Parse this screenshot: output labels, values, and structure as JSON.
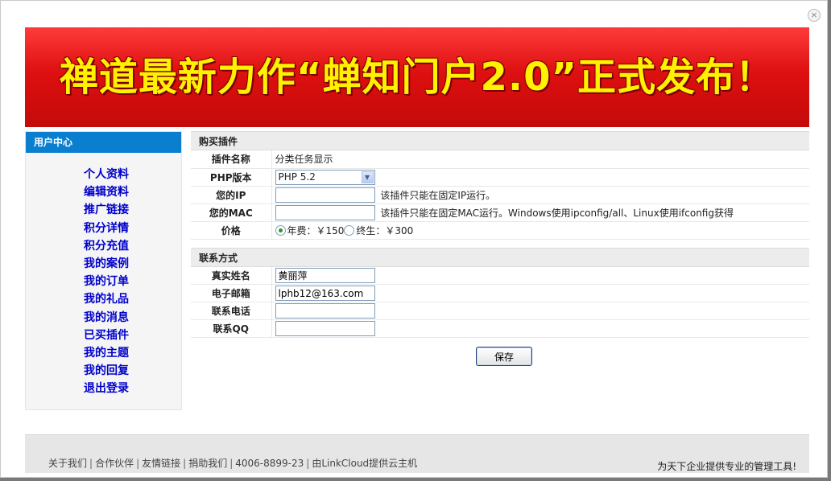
{
  "banner": {
    "headline": "禅道最新力作“蝉知门户2.0”正式发布！"
  },
  "close": {
    "symbol": "×"
  },
  "sidebar": {
    "title": "用户中心",
    "items": [
      {
        "label": "个人资料"
      },
      {
        "label": "编辑资料"
      },
      {
        "label": "推广链接"
      },
      {
        "label": "积分详情"
      },
      {
        "label": "积分充值"
      },
      {
        "label": "我的案例"
      },
      {
        "label": "我的订单"
      },
      {
        "label": "我的礼品"
      },
      {
        "label": "我的消息"
      },
      {
        "label": "已买插件"
      },
      {
        "label": "我的主题"
      },
      {
        "label": "我的回复"
      },
      {
        "label": "退出登录"
      }
    ]
  },
  "purchase": {
    "title": "购买插件",
    "plugin_name_label": "插件名称",
    "plugin_name_value": "分类任务显示",
    "php_label": "PHP版本",
    "php_selected": "PHP 5.2",
    "ip_label": "您的IP",
    "ip_value": "",
    "ip_hint": "该插件只能在固定IP运行。",
    "mac_label": "您的MAC",
    "mac_value": "",
    "mac_hint": "该插件只能在固定MAC运行。Windows使用ipconfig/all、Linux使用ifconfig获得",
    "price_label": "价格",
    "price_annual": "年费：￥150",
    "price_lifetime": "终生：￥300"
  },
  "contact": {
    "title": "联系方式",
    "name_label": "真实姓名",
    "name_value": "黄丽萍",
    "email_label": "电子邮箱",
    "email_value": "lphb12@163.com",
    "phone_label": "联系电话",
    "phone_value": "",
    "qq_label": "联系QQ",
    "qq_value": ""
  },
  "actions": {
    "save_label": "保存"
  },
  "footer": {
    "links": [
      "关于我们",
      "合作伙伴",
      "友情链接",
      "捐助我们",
      "4006-8899-23",
      "由LinkCloud提供云主机"
    ],
    "separator": "|",
    "slogan": "为天下企业提供专业的管理工具!"
  },
  "colors": {
    "sidebar_header": "#0a7fd0",
    "sidebar_link": "#0000cc",
    "banner_bg": "#e01010",
    "banner_text": "#fff200"
  }
}
